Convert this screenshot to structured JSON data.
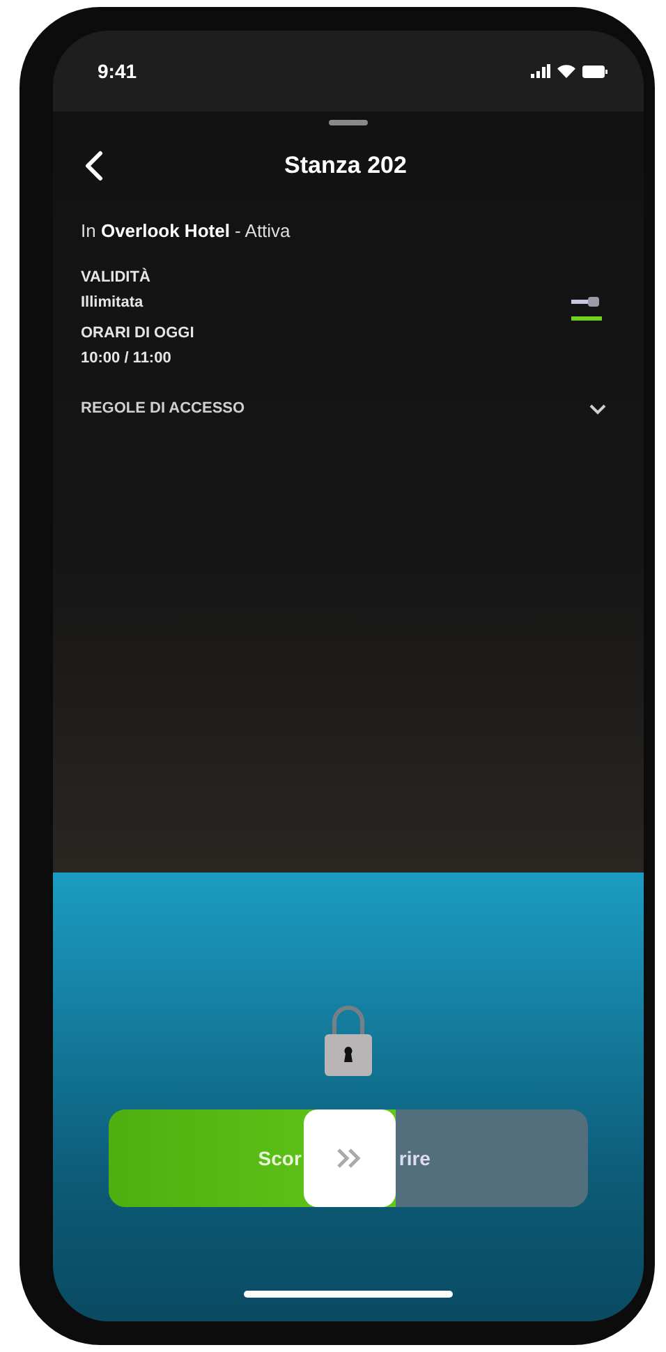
{
  "status_bar": {
    "time": "9:41"
  },
  "header": {
    "title": "Stanza 202"
  },
  "subtitle": "In **Overlook Hotel** - Attiva",
  "details": [
    {
      "label": "VALIDITÀ",
      "value": "Illimitata"
    },
    {
      "label": "ORARI DI OGGI",
      "value": "10:00 / 11:00"
    }
  ],
  "access_rules": {
    "label": "REGOLE DI ACCESSO",
    "expanded": false
  },
  "unlock": {
    "locked": true,
    "slider": {
      "label_start": "Scor",
      "label_end": "rire",
      "level": 0.6
    }
  }
}
